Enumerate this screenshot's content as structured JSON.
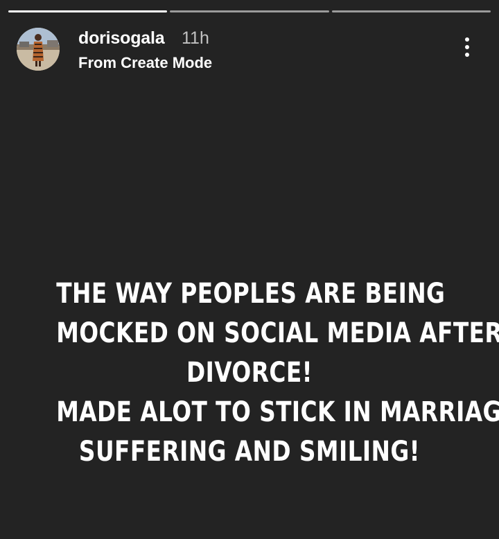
{
  "progress": {
    "segments": [
      {
        "fill_fraction": 1.0
      },
      {
        "fill_fraction": 0.0
      },
      {
        "fill_fraction": 0.0
      }
    ]
  },
  "header": {
    "username": "dorisogala",
    "timestamp": "11h",
    "subtitle": "From Create Mode",
    "more_icon": "more-vertical-icon"
  },
  "story": {
    "lines": [
      "THE WAY PEOPLES ARE BEING",
      "MOCKED ON SOCIAL MEDIA AFTER",
      "DIVORCE!",
      "MADE ALOT TO STICK IN MARRIAGE",
      "SUFFERING AND SMILING!"
    ],
    "background_color": "#232323",
    "text_color": "#ffffff"
  }
}
